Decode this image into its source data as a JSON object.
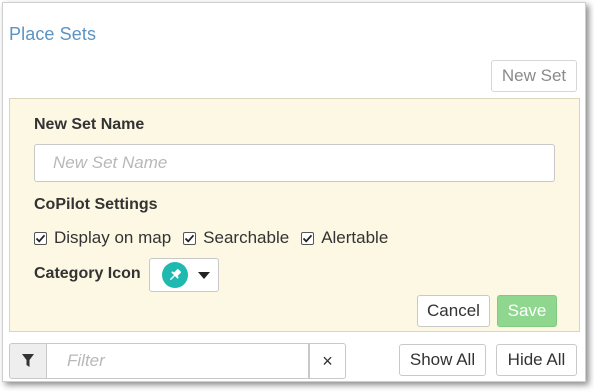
{
  "header": {
    "title": "Place Sets",
    "new_set_label": "New Set"
  },
  "form": {
    "name_label": "New Set Name",
    "name_placeholder": "New Set Name",
    "name_value": "",
    "copilot_label": "CoPilot Settings",
    "options": [
      {
        "label": "Display on map",
        "checked": true
      },
      {
        "label": "Searchable",
        "checked": true
      },
      {
        "label": "Alertable",
        "checked": true
      }
    ],
    "category_icon_label": "Category Icon",
    "category_icon": {
      "name": "pushpin-icon",
      "color": "#20b9b0"
    },
    "cancel_label": "Cancel",
    "save_label": "Save"
  },
  "footer": {
    "filter_icon": "filter-icon",
    "filter_placeholder": "Filter",
    "clear_label": "×",
    "show_all_label": "Show All",
    "hide_all_label": "Hide All"
  },
  "colors": {
    "title": "#5b93c3",
    "panel_background": "#fcf8e3",
    "save_button": "#8fd78f",
    "icon_accent": "#20b9b0"
  }
}
